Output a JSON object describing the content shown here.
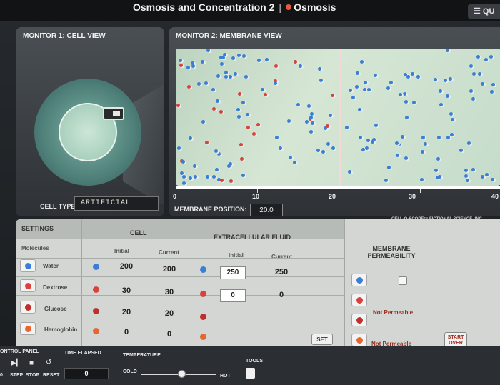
{
  "header": {
    "title": "Osmosis and Concentration 2",
    "subtitle": "Osmosis",
    "menu_label": "QU"
  },
  "monitor1": {
    "title": "MONITOR 1: CELL VIEW",
    "cell_type_label": "CELL TYPE:",
    "cell_type_value": "ARTIFICIAL"
  },
  "monitor2": {
    "title": "MONITOR 2: MEMBRANE VIEW",
    "ruler_ticks": [
      "0",
      "10",
      "20",
      "30",
      "40"
    ],
    "membrane_position_label": "MEMBRANE POSITION:",
    "membrane_position_value": "20.0",
    "credit": "CELL-O-SCOPE™ FICTIONAL SCIENCE, INC.",
    "membrane_position_fraction": 0.5
  },
  "settings": {
    "title": "SETTINGS",
    "cell_header": "CELL",
    "extracellular_header": "EXTRACELLULAR FLUID",
    "molecules_header": "Molecules",
    "initial_label": "Initial",
    "current_label": "Current",
    "membrane_permeability_label": "MEMBRANE PERMEABILITY",
    "set_label": "SET",
    "start_over_label": "START OVER",
    "rows": [
      {
        "name": "Water",
        "cell_initial": "200",
        "cell_current": "200",
        "ext_initial": "250",
        "ext_current": "250",
        "permeability": "",
        "color": "#3a7fd5"
      },
      {
        "name": "Dextrose",
        "cell_initial": "30",
        "cell_current": "30",
        "ext_initial": "0",
        "ext_current": "0",
        "permeability": "Not Permeable",
        "color": "#d9423a"
      },
      {
        "name": "Glucose",
        "cell_initial": "20",
        "cell_current": "20",
        "ext_initial": "",
        "ext_current": "",
        "permeability": "",
        "color": "#c0302b"
      },
      {
        "name": "Hemoglobin",
        "cell_initial": "0",
        "cell_current": "0",
        "ext_initial": "",
        "ext_current": "",
        "permeability": "Not Permeable",
        "color": "#e5672f"
      }
    ]
  },
  "control_panel": {
    "title": "ONTROL PANEL",
    "time_elapsed_label": "TIME ELAPSED",
    "time_elapsed_value": "0",
    "temperature_label": "TEMPERATURE",
    "cold_label": "COLD",
    "hot_label": "HOT",
    "tools_label": "TOOLS",
    "step_label": "STEP",
    "stop_label": "STOP",
    "reset_label": "RESET",
    "left_digit": "0",
    "temperature_fraction": 0.55
  },
  "colors": {
    "water": "#3a7fd5",
    "solute": "#d9423a",
    "membrane": "#f4d7d7",
    "accent_red": "#a02b1f"
  },
  "icons": [
    "microscope-icon",
    "play-icon",
    "stop-icon",
    "reset-icon",
    "tools-icon"
  ]
}
